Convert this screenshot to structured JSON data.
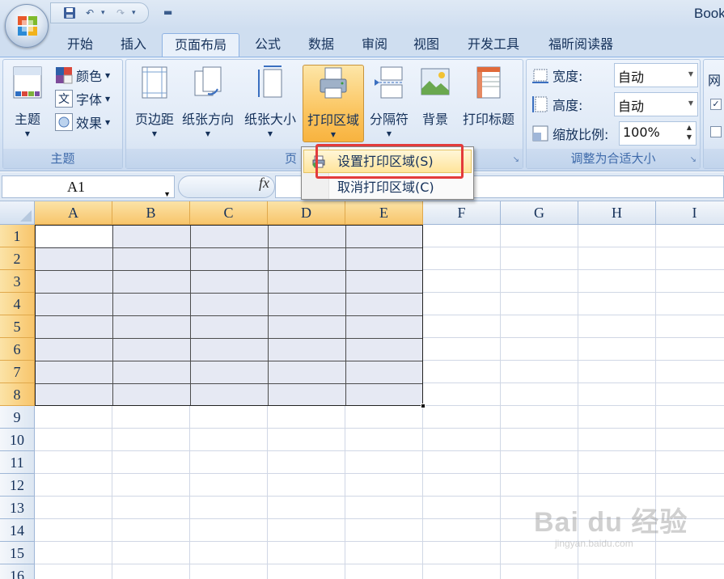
{
  "window": {
    "title": "Book"
  },
  "qat": {
    "save": "save-icon",
    "undo": "undo-icon",
    "redo": "redo-icon"
  },
  "tabs": [
    {
      "label": "开始"
    },
    {
      "label": "插入"
    },
    {
      "label": "页面布局"
    },
    {
      "label": "公式"
    },
    {
      "label": "数据"
    },
    {
      "label": "审阅"
    },
    {
      "label": "视图"
    },
    {
      "label": "开发工具"
    },
    {
      "label": "福昕阅读器"
    }
  ],
  "ribbon": {
    "themes": {
      "label": "主题",
      "button": "主题",
      "colors": "颜色",
      "fonts": "字体",
      "effects": "效果",
      "font_glyph": "文",
      "theme_glyph": "文文"
    },
    "page_setup": {
      "label": "页",
      "margins": "页边距",
      "orientation": "纸张方向",
      "size": "纸张大小",
      "print_area": "打印区域",
      "breaks": "分隔符",
      "background": "背景",
      "print_titles": "打印标题"
    },
    "scale": {
      "label": "调整为合适大小",
      "width_label": "宽度:",
      "width_value": "自动",
      "height_label": "高度:",
      "height_value": "自动",
      "scale_label": "缩放比例:",
      "scale_value": "100%"
    },
    "sheet_options": {
      "label_partial": "网"
    }
  },
  "dropdown": {
    "set_print_area": "设置打印区域(S)",
    "clear_print_area": "取消打印区域(C)"
  },
  "formula_bar": {
    "name_box": "A1",
    "fx": "fx"
  },
  "grid": {
    "columns": [
      "A",
      "B",
      "C",
      "D",
      "E",
      "F",
      "G",
      "H",
      "I"
    ],
    "rows": [
      "1",
      "2",
      "3",
      "4",
      "5",
      "6",
      "7",
      "8",
      "9",
      "10",
      "11",
      "12",
      "13",
      "14",
      "15",
      "16"
    ]
  },
  "watermark": {
    "main": "Bai du 经验",
    "sub": "jingyan.baidu.com"
  }
}
